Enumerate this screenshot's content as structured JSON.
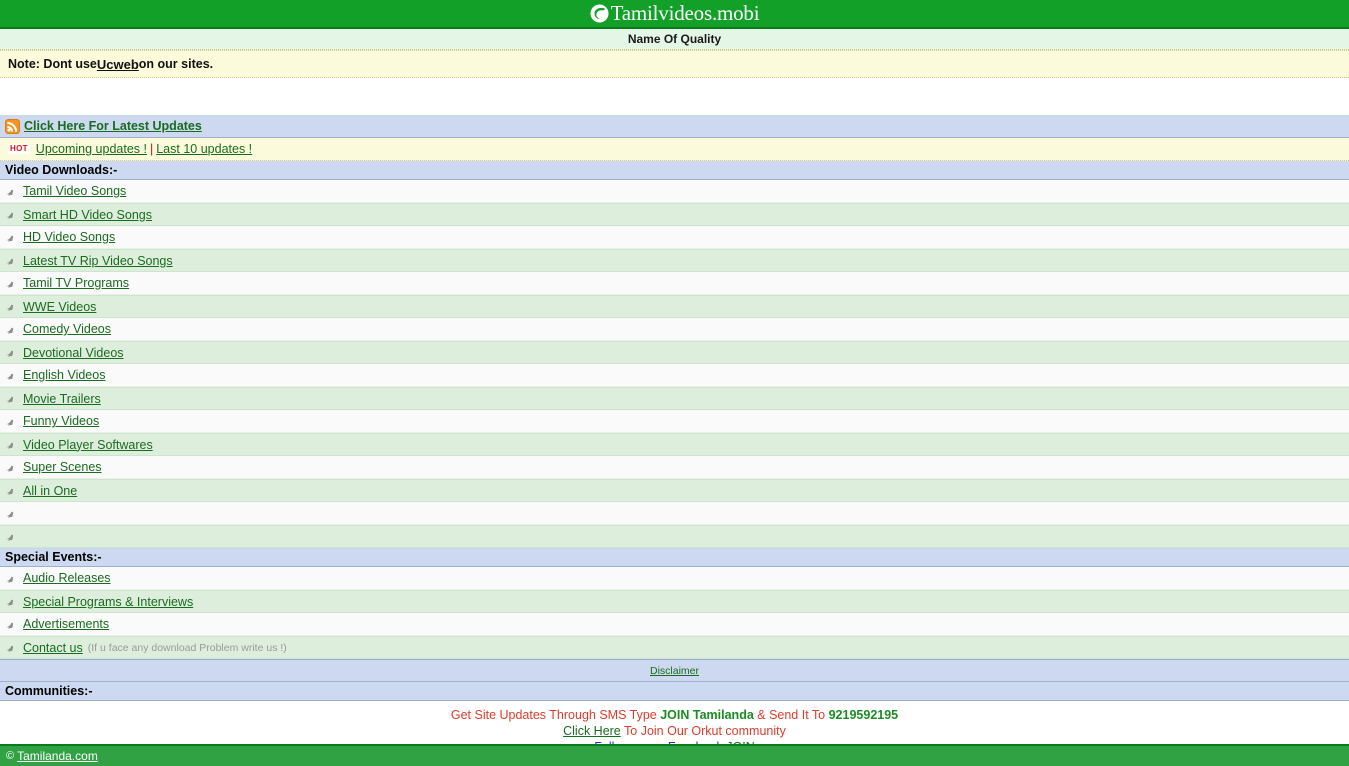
{
  "header": {
    "logo_icon": "circular-swirl-logo-icon",
    "site_title": "Tamilvideos.mobi",
    "subtitle": "Name Of Quality"
  },
  "note": {
    "prefix": "Note: Dont use ",
    "link": "Ucweb",
    "suffix": " on our sites."
  },
  "rss": {
    "icon": "rss-feed-icon",
    "label": "Click Here For Latest Updates"
  },
  "updates": {
    "badge": "HOT",
    "first_link": "Upcoming updates !",
    "separator": "|",
    "second_link": "Last 10 updates !"
  },
  "sections": [
    {
      "title": "Video Downloads:-",
      "items": [
        {
          "label": "Tamil Video Songs",
          "note": ""
        },
        {
          "label": "Smart HD Video Songs",
          "note": ""
        },
        {
          "label": "HD Video Songs",
          "note": ""
        },
        {
          "label": "Latest TV Rip Video Songs",
          "note": ""
        },
        {
          "label": "Tamil TV Programs",
          "note": ""
        },
        {
          "label": "WWE Videos",
          "note": ""
        },
        {
          "label": "Comedy Videos",
          "note": ""
        },
        {
          "label": "Devotional Videos",
          "note": ""
        },
        {
          "label": "English Videos",
          "note": ""
        },
        {
          "label": "Movie Trailers",
          "note": ""
        },
        {
          "label": "Funny Videos",
          "note": ""
        },
        {
          "label": "Video Player Softwares",
          "note": ""
        },
        {
          "label": "Super Scenes",
          "note": ""
        },
        {
          "label": "All in One",
          "note": ""
        },
        {
          "label": "",
          "note": ""
        },
        {
          "label": "",
          "note": ""
        }
      ]
    },
    {
      "title": "Special Events:-",
      "items": [
        {
          "label": "Audio Releases",
          "note": ""
        },
        {
          "label": "Special Programs & Interviews",
          "note": ""
        },
        {
          "label": "Advertisements",
          "note": ""
        },
        {
          "label": "Contact us",
          "note": "(If u face any download Problem write us !)"
        }
      ]
    }
  ],
  "disclaimer": {
    "label": "Disclaimer"
  },
  "communities": {
    "title": "Communities:-",
    "sms_line": {
      "part1": "Get Site Updates Through SMS Type ",
      "join_keyword": "JOIN Tamilanda",
      "part2": " & Send It To ",
      "number": "9219592195"
    },
    "orkut_line": {
      "link": "Click Here",
      "text": " To Join Our Orkut community"
    },
    "facebook_line": {
      "text": "Follow us on Facebook ",
      "link": "JOIN"
    }
  },
  "footer": {
    "copyright_symbol": "©",
    "site": "Tamilanda.com"
  },
  "colors": {
    "brand_green": "#12a028",
    "footer_green": "#31a244",
    "section_blue": "#ccd9f0",
    "row_green": "#deeedd",
    "row_white": "#fafafa",
    "note_yellow": "#fbfbdb",
    "link_green": "#1a6b1f",
    "hot_red": "#d81414",
    "sms_red": "#e03c2c",
    "facebook_blue": "#2030d8"
  }
}
